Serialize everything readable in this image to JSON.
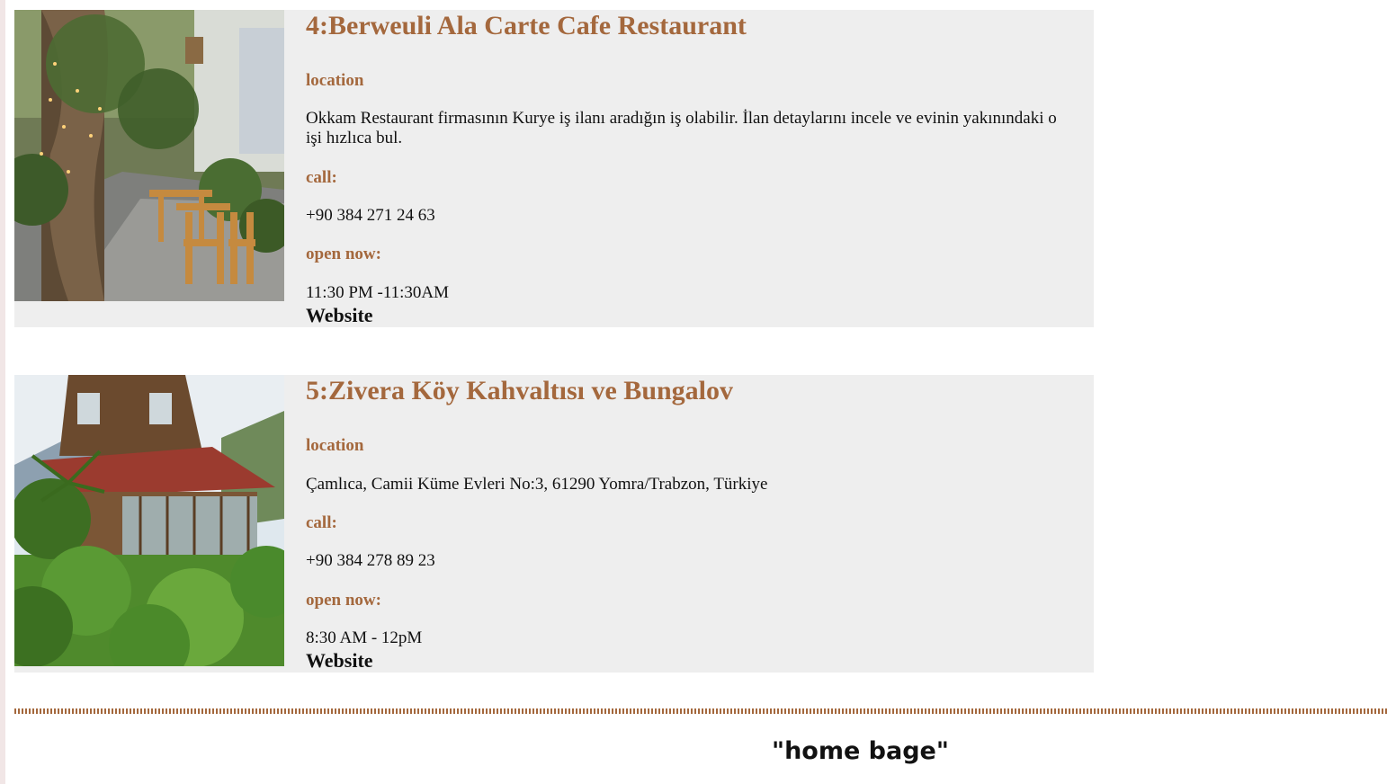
{
  "restaurants": [
    {
      "title": "4:Berweuli Ala Carte Cafe Restaurant",
      "location_label": "location",
      "location": "Okkam Restaurant firmasının Kurye iş ilanı aradığın iş olabilir. İlan detaylarını incele ve evinin yakınındaki o işi hızlıca bul.",
      "call_label": "call:",
      "phone": "+90 384 271 24 63",
      "open_label": "open now:",
      "hours": "11:30 PM -11:30AM",
      "website_label": "Website"
    },
    {
      "title": "5:Zivera Köy Kahvaltısı ve Bungalov",
      "location_label": "location",
      "location": "Çamlıca, Camii Küme Evleri No:3, 61290 Yomra/Trabzon, Türkiye",
      "call_label": "call:",
      "phone": "+90 384 278 89 23",
      "open_label": "open now:",
      "hours": "8:30 AM - 12pM",
      "website_label": "Website"
    }
  ],
  "footer": {
    "home_label": "\"home bage\""
  },
  "colors": {
    "accent": "#a4683d",
    "card_bg": "#eeeeee"
  }
}
